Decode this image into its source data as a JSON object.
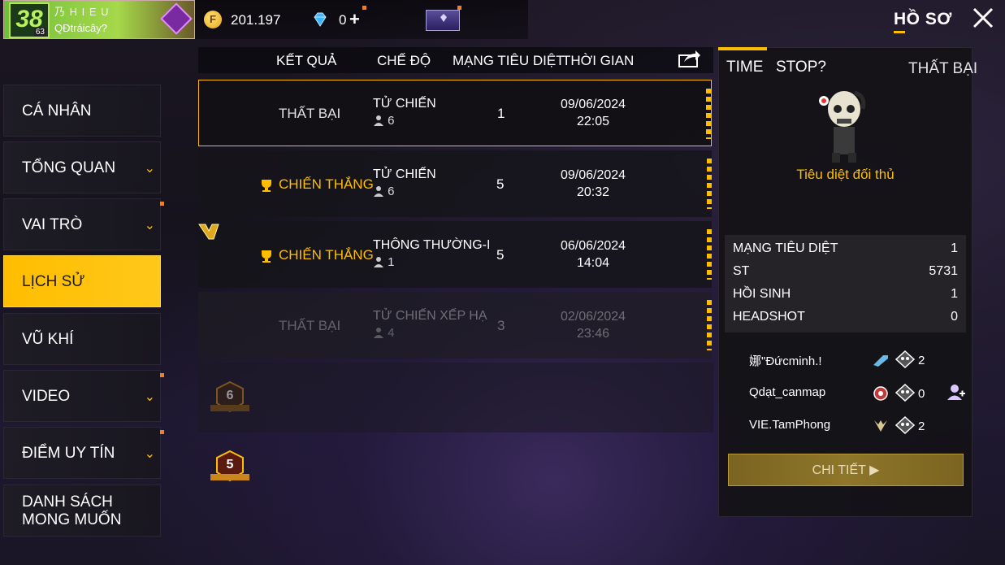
{
  "player": {
    "level": "38",
    "sub_level": "63",
    "name": "乃 H I E U",
    "status": "QĐtráicây?"
  },
  "currency": {
    "gold_symbol": "F",
    "gold": "201.197",
    "diamonds": "0",
    "plus": "+"
  },
  "header": {
    "profile_tab": "HỒ SƠ",
    "close_icon": "close-icon"
  },
  "sidebar": {
    "items": [
      {
        "label": "CÁ NHÂN",
        "chevron": false,
        "dot": false
      },
      {
        "label": "TỔNG QUAN",
        "chevron": true,
        "dot": false
      },
      {
        "label": "VAI TRÒ",
        "chevron": true,
        "dot": true
      },
      {
        "label": "LỊCH SỬ",
        "chevron": false,
        "dot": false,
        "active": true
      },
      {
        "label": "VŨ KHÍ",
        "chevron": false,
        "dot": false
      },
      {
        "label": "VIDEO",
        "chevron": true,
        "dot": true
      },
      {
        "label": "ĐIỂM UY TÍN",
        "chevron": true,
        "dot": true
      },
      {
        "label_line1": "DANH SÁCH",
        "label_line2": "MONG MUỐN",
        "chevron": false,
        "dot": false
      }
    ]
  },
  "history": {
    "columns": {
      "result": "KẾT QUẢ",
      "mode": "CHẾ ĐỘ",
      "kills": "MẠNG TIÊU DIỆT",
      "time": "THỜI GIAN"
    },
    "rows": [
      {
        "result": "THẤT BẠI",
        "win": false,
        "mode": "TỬ CHIẾN",
        "players": "6",
        "kills": "1",
        "date": "09/06/2024",
        "time": "22:05",
        "selected": true,
        "faded": false
      },
      {
        "result": "CHIẾN THẮNG",
        "win": true,
        "mode": "TỬ CHIẾN",
        "players": "6",
        "kills": "5",
        "date": "09/06/2024",
        "time": "20:32",
        "selected": false,
        "faded": false
      },
      {
        "result": "CHIẾN THẮNG",
        "win": true,
        "mode": "THÔNG THƯỜNG-I",
        "players": "1",
        "kills": "5",
        "date": "06/06/2024",
        "time": "14:04",
        "selected": false,
        "faded": false
      },
      {
        "result": "THẤT BẠI",
        "win": false,
        "mode": "TỬ CHIẾN XẾP HẠ",
        "players": "4",
        "kills": "3",
        "date": "02/06/2024",
        "time": "23:46",
        "selected": false,
        "faded": true
      }
    ],
    "booyah_badges": [
      "6",
      "5"
    ]
  },
  "detail": {
    "time_label": "TIME",
    "stop_label": "STOP?",
    "result": "THẤT BẠI",
    "caption": "Tiêu diệt đối thủ",
    "stats": [
      {
        "label": "MẠNG TIÊU DIỆT",
        "value": "1"
      },
      {
        "label": "ST",
        "value": "5731"
      },
      {
        "label": "HỒI SINH",
        "value": "1"
      },
      {
        "label": "HEADSHOT",
        "value": "0"
      }
    ],
    "team": [
      {
        "name": "娜\"Đứcminh.!",
        "kills": "2"
      },
      {
        "name": "Qdạt_canmap",
        "kills": "0"
      },
      {
        "name": "VIE.TamPhong",
        "kills": "2"
      }
    ],
    "detail_button": "CHI TIẾT"
  },
  "colors": {
    "accent": "#ffbd00",
    "panel": "#16141a",
    "orange_dot": "#ff7a1a"
  }
}
